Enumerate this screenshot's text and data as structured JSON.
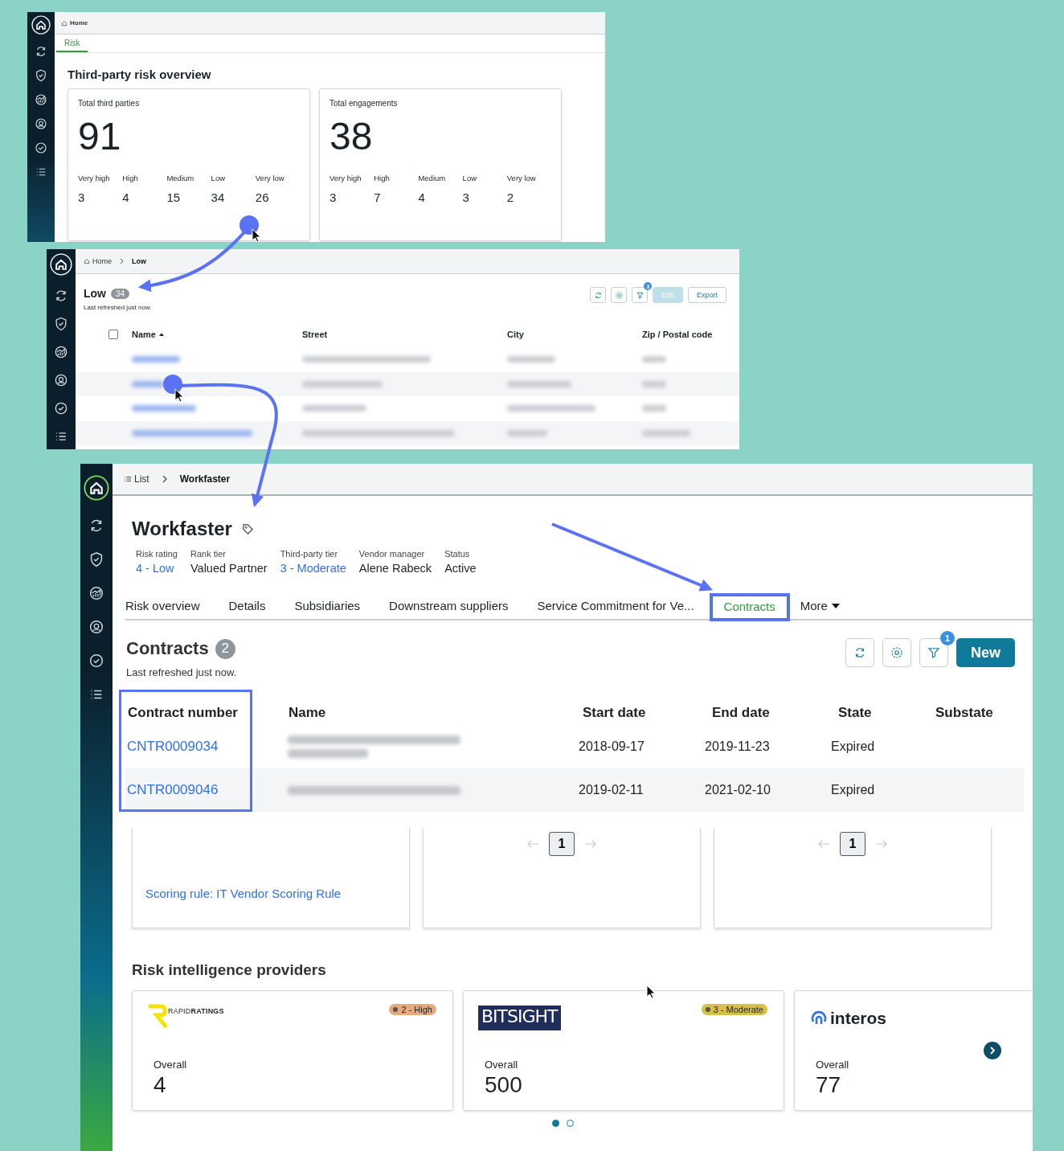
{
  "overview_screen": {
    "breadcrumb": "Home",
    "tabs": [
      {
        "label": "Risk",
        "selected": true
      }
    ],
    "title": "Third-party risk overview",
    "cards": [
      {
        "label": "Total third parties",
        "total": "91",
        "breakdown": [
          {
            "label": "Very high",
            "value": "3"
          },
          {
            "label": "High",
            "value": "4"
          },
          {
            "label": "Medium",
            "value": "15"
          },
          {
            "label": "Low",
            "value": "34"
          },
          {
            "label": "Very low",
            "value": "26"
          }
        ]
      },
      {
        "label": "Total engagements",
        "total": "38",
        "breakdown": [
          {
            "label": "Very high",
            "value": "3"
          },
          {
            "label": "High",
            "value": "7"
          },
          {
            "label": "Medium",
            "value": "4"
          },
          {
            "label": "Low",
            "value": "3"
          },
          {
            "label": "Very low",
            "value": "2"
          }
        ]
      }
    ]
  },
  "list_screen": {
    "breadcrumbs": [
      "Home",
      "Low"
    ],
    "title": "Low",
    "count": "34",
    "refreshed": "Last refreshed just now.",
    "filter_count": "3",
    "select_all_checked": false,
    "buttons": [
      {
        "label": "Edit",
        "disabled": true
      },
      {
        "label": "Export",
        "disabled": false
      }
    ],
    "columns": [
      {
        "label": "Name",
        "sorted": true
      },
      {
        "label": "Street",
        "sorted": false
      },
      {
        "label": "City",
        "sorted": false
      },
      {
        "label": "Zip / Postal code",
        "sorted": false
      }
    ]
  },
  "record_screen": {
    "breadcrumbs": [
      "List",
      "Workfaster"
    ],
    "title": "Workfaster",
    "fields": [
      {
        "label": "Risk rating",
        "value": "4 - Low",
        "link": true
      },
      {
        "label": "Rank tier",
        "value": "Valued Partner",
        "link": false
      },
      {
        "label": "Third-party tier",
        "value": "3 - Moderate",
        "link": true
      },
      {
        "label": "Vendor manager",
        "value": "Alene Rabeck",
        "link": false
      },
      {
        "label": "Status",
        "value": "Active",
        "link": false
      }
    ],
    "tabs": [
      {
        "label": "Risk overview",
        "selected": false,
        "highlighted": false
      },
      {
        "label": "Details",
        "selected": false,
        "highlighted": false
      },
      {
        "label": "Subsidiaries",
        "selected": false,
        "highlighted": false
      },
      {
        "label": "Downstream suppliers",
        "selected": false,
        "highlighted": false
      },
      {
        "label": "Service Commitment for Ve...",
        "selected": false,
        "highlighted": false
      },
      {
        "label": "Contracts",
        "selected": true,
        "highlighted": true
      }
    ],
    "more_tab": "More",
    "contracts": {
      "title": "Contracts",
      "count": "2",
      "refreshed": "Last refreshed just now.",
      "filter_count": "1",
      "new_button": "New",
      "columns": [
        {
          "label": "Contract number",
          "highlighted": true
        },
        {
          "label": "Name",
          "highlighted": false
        },
        {
          "label": "Start date",
          "highlighted": false
        },
        {
          "label": "End date",
          "highlighted": false
        },
        {
          "label": "State",
          "highlighted": false
        },
        {
          "label": "Substate",
          "highlighted": false
        }
      ],
      "rows": [
        {
          "contract_number": "CNTR0009034",
          "start_date": "2018-09-17",
          "end_date": "2019-11-23",
          "state": "Expired"
        },
        {
          "contract_number": "CNTR0009046",
          "start_date": "2019-02-11",
          "end_date": "2021-02-10",
          "state": "Expired"
        }
      ]
    },
    "summary_cards": [
      {
        "kind": "link",
        "text": "Scoring rule: IT Vendor Scoring Rule"
      },
      {
        "kind": "pager",
        "text": "1"
      },
      {
        "kind": "pager",
        "text": "1"
      }
    ],
    "providers": {
      "title": "Risk intelligence providers",
      "items": [
        {
          "kind": "rapid",
          "logo": "RAPID**RATINGS**",
          "badge": {
            "label": "2 - High",
            "color": "#e4ab82"
          },
          "label": "Overall",
          "value": "4"
        },
        {
          "kind": "bitsight",
          "logo": "BITSIGHT",
          "badge": {
            "label": "3 - Moderate",
            "color": "#d6c04a"
          },
          "label": "Overall",
          "value": "500"
        },
        {
          "kind": "interos",
          "logo": "interos",
          "label": "Overall",
          "value": "77"
        }
      ],
      "pages": [
        {
          "selected": true
        },
        {
          "selected": false
        }
      ]
    }
  }
}
